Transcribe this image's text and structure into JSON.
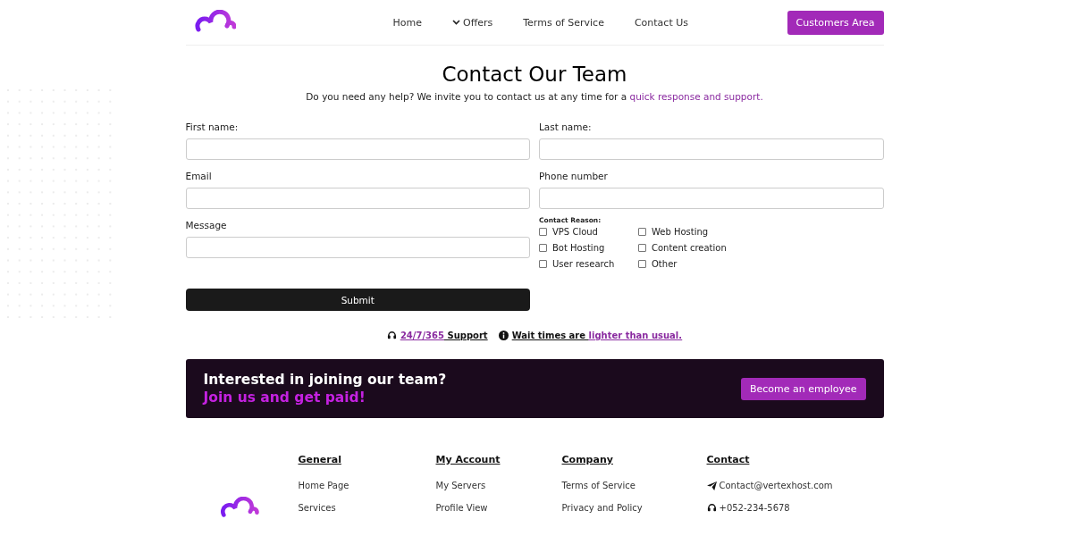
{
  "nav": {
    "links": [
      {
        "label": "Home",
        "dropdown": false
      },
      {
        "label": "Offers",
        "dropdown": true
      },
      {
        "label": "Terms of Service",
        "dropdown": false
      },
      {
        "label": "Contact Us",
        "dropdown": false
      }
    ],
    "cta": "Customers Area"
  },
  "heading": {
    "title": "Contact Our Team",
    "intro": "Do you need any help? We invite you to contact us at any time for a ",
    "intro_link": "quick response and support."
  },
  "form": {
    "left": [
      {
        "label": "First name:"
      },
      {
        "label": "Email"
      },
      {
        "label": "Message"
      }
    ],
    "right": [
      {
        "label": "Last name:"
      },
      {
        "label": "Phone number"
      }
    ],
    "reason_label": "Contact Reason:",
    "reasons": [
      {
        "label": "VPS Cloud",
        "checked": false
      },
      {
        "label": "Web Hosting",
        "checked": false
      },
      {
        "label": "Bot Hosting",
        "checked": false
      },
      {
        "label": "Content creation",
        "checked": false
      },
      {
        "label": "User research",
        "checked": false
      },
      {
        "label": "Other",
        "checked": false
      }
    ],
    "submit": "Submit"
  },
  "notes": {
    "support_link": "24/7/365",
    "support_text": "Support",
    "wait_text": "Wait times are",
    "wait_link": "lighter than usual."
  },
  "banner": {
    "title": "Interested in joining our team?",
    "subtitle": "Join us and get paid!",
    "button": "Become an employee"
  },
  "footer": {
    "columns": [
      {
        "title": "General",
        "links": [
          {
            "label": "Home Page",
            "kind": "text"
          },
          {
            "label": "Services",
            "kind": "text"
          }
        ]
      },
      {
        "title": "My Account",
        "links": [
          {
            "label": "My Servers",
            "kind": "text"
          },
          {
            "label": "Profile View",
            "kind": "text"
          }
        ]
      },
      {
        "title": "Company",
        "links": [
          {
            "label": "Terms of Service",
            "kind": "text"
          },
          {
            "label": "Privacy and Policy",
            "kind": "text"
          }
        ]
      },
      {
        "title": "Contact",
        "links": [
          {
            "label": "Contact@vertexhost.com",
            "kind": "email"
          },
          {
            "label": "+052-234-5678",
            "kind": "phone"
          }
        ]
      }
    ]
  }
}
